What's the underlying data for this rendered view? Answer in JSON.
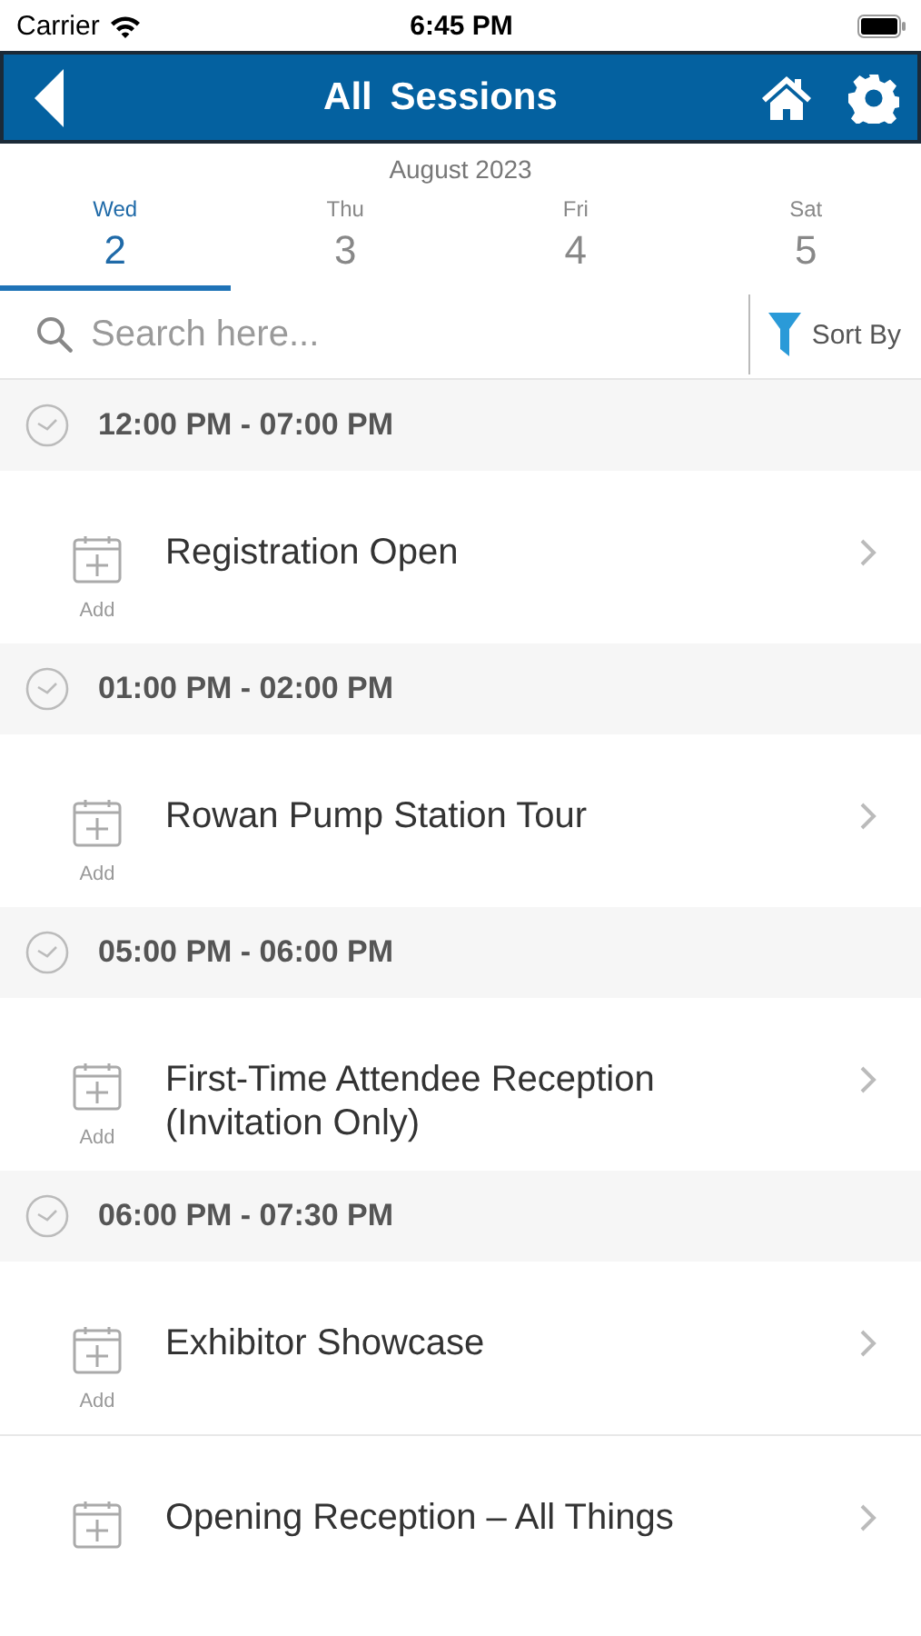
{
  "status_bar": {
    "carrier": "Carrier",
    "time": "6:45 PM"
  },
  "header": {
    "title": "All Sessions"
  },
  "month": "August 2023",
  "days": [
    {
      "weekday": "Wed",
      "date": "2",
      "selected": true
    },
    {
      "weekday": "Thu",
      "date": "3",
      "selected": false
    },
    {
      "weekday": "Fri",
      "date": "4",
      "selected": false
    },
    {
      "weekday": "Sat",
      "date": "5",
      "selected": false
    }
  ],
  "search": {
    "placeholder": "Search here..."
  },
  "sort": {
    "label": "Sort By"
  },
  "groups": [
    {
      "time": "12:00 PM - 07:00 PM",
      "sessions": [
        {
          "title": "Registration Open",
          "add_label": "Add"
        }
      ]
    },
    {
      "time": "01:00 PM - 02:00 PM",
      "sessions": [
        {
          "title": "Rowan Pump Station Tour",
          "add_label": "Add"
        }
      ]
    },
    {
      "time": "05:00 PM - 06:00 PM",
      "sessions": [
        {
          "title": "First-Time Attendee Reception (Invitation Only)",
          "add_label": "Add"
        }
      ]
    },
    {
      "time": "06:00 PM - 07:30 PM",
      "sessions": [
        {
          "title": "Exhibitor Showcase",
          "add_label": "Add"
        },
        {
          "title": "Opening Reception – All Things"
        }
      ]
    }
  ]
}
